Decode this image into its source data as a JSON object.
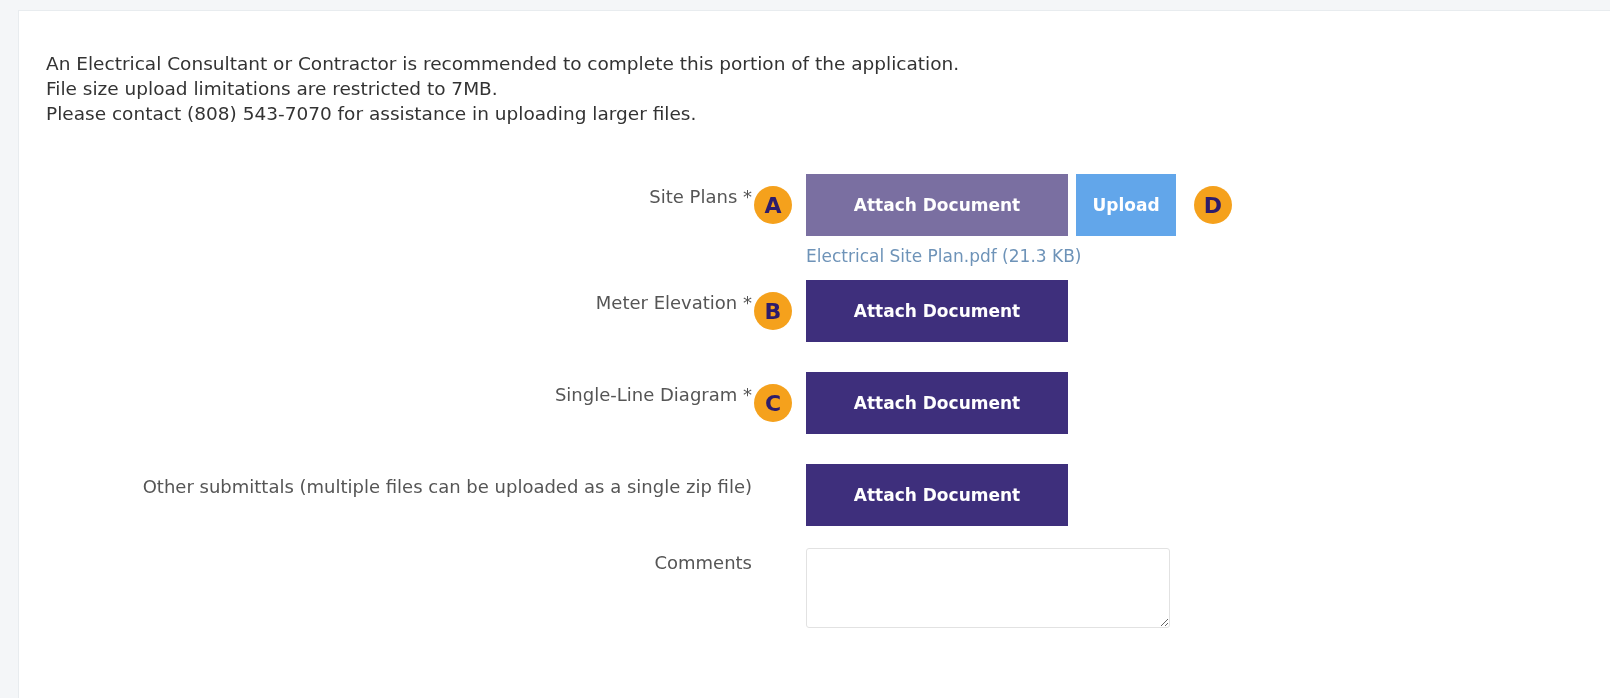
{
  "intro": [
    "An Electrical Consultant or Contractor is recommended to complete this portion of the application.",
    "File size upload limitations are restricted to 7MB.",
    "Please contact (808) 543-7070 for assistance in uploading larger files."
  ],
  "fields": [
    {
      "kind": "attach",
      "label": "Site Plans *",
      "callout": "A",
      "button": "Attach Document",
      "attached": true,
      "upload": {
        "label": "Upload",
        "callout": "D"
      },
      "file": "Electrical Site Plan.pdf (21.3 KB)"
    },
    {
      "kind": "attach",
      "label": "Meter Elevation *",
      "callout": "B",
      "button": "Attach Document",
      "attached": false
    },
    {
      "kind": "attach",
      "label": "Single-Line Diagram *",
      "callout": "C",
      "button": "Attach Document",
      "attached": false
    },
    {
      "kind": "attach",
      "label": "Other submittals (multiple files can be uploaded as a single zip file)",
      "button": "Attach Document",
      "attached": false
    },
    {
      "kind": "textarea",
      "label": "Comments"
    }
  ]
}
